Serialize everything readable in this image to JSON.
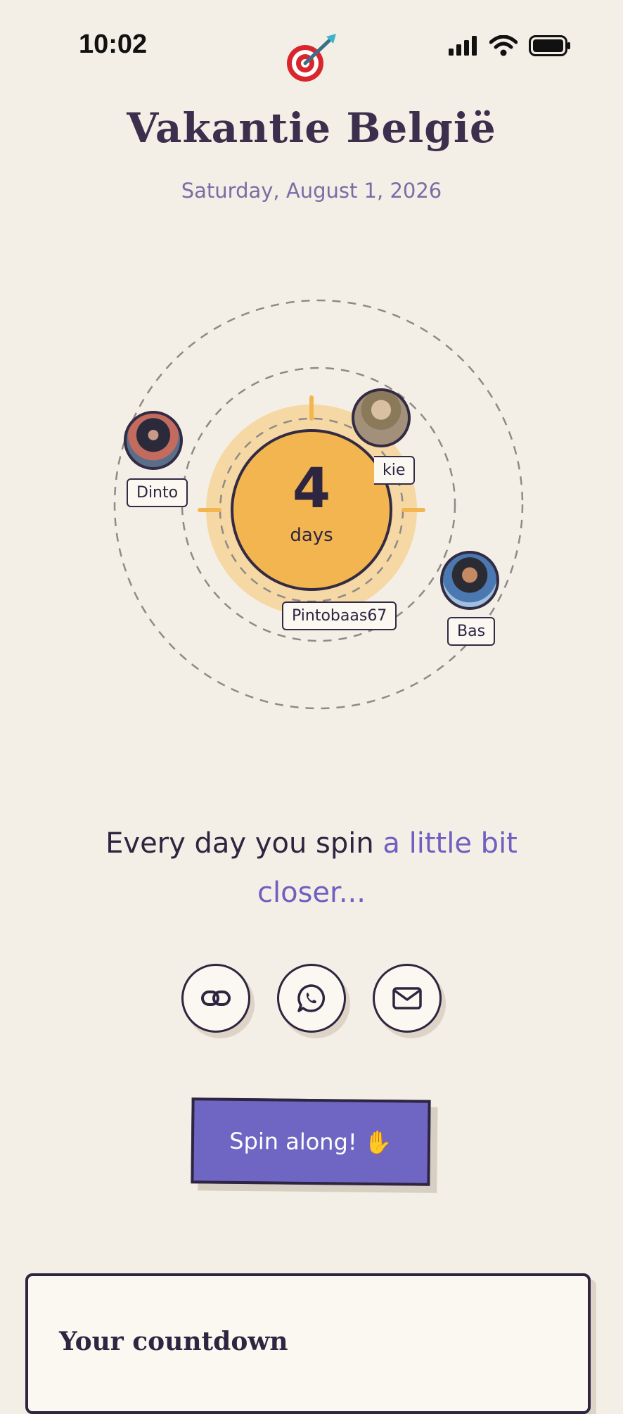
{
  "status_bar": {
    "time": "10:02"
  },
  "header": {
    "title": "Vakantie België",
    "date": "Saturday, August 1, 2026"
  },
  "countdown": {
    "value": "4",
    "unit": "days"
  },
  "participants": [
    {
      "name": "Dinto"
    },
    {
      "name": "kie"
    },
    {
      "name": "Pintobaas67"
    },
    {
      "name": "Bas"
    }
  ],
  "tagline": {
    "main": "Every day you spin ",
    "accent": "a little bit closer..."
  },
  "share": {
    "icons": [
      "link-icon",
      "whatsapp-icon",
      "mail-icon"
    ]
  },
  "cta": {
    "label": "Spin along! ✋"
  },
  "card": {
    "title": "Your countdown"
  },
  "colors": {
    "accent": "#6f66c4",
    "sun": "#f3b54f",
    "ink": "#2e2540",
    "background": "#f4efe6"
  }
}
